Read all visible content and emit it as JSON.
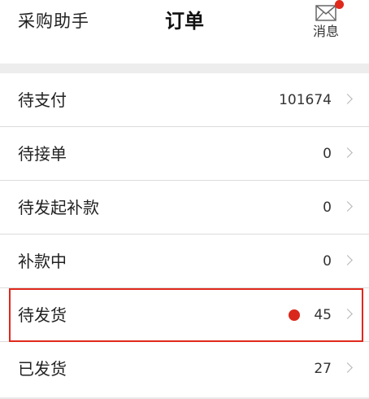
{
  "header": {
    "back_label": "采购助手",
    "title": "订单",
    "message_label": "消息",
    "message_badge_color": "#e0281c"
  },
  "orders": [
    {
      "label": "待支付",
      "value": "101674"
    },
    {
      "label": "待接单",
      "value": "0"
    },
    {
      "label": "待发起补款",
      "value": "0"
    },
    {
      "label": "补款中",
      "value": "0"
    },
    {
      "label": "待发货",
      "value": "45",
      "has_dot": true,
      "highlighted": true
    },
    {
      "label": "已发货",
      "value": "27"
    }
  ],
  "colors": {
    "accent": "#e0281c",
    "divider": "#dcdcdc",
    "section_gap": "#ededed"
  }
}
